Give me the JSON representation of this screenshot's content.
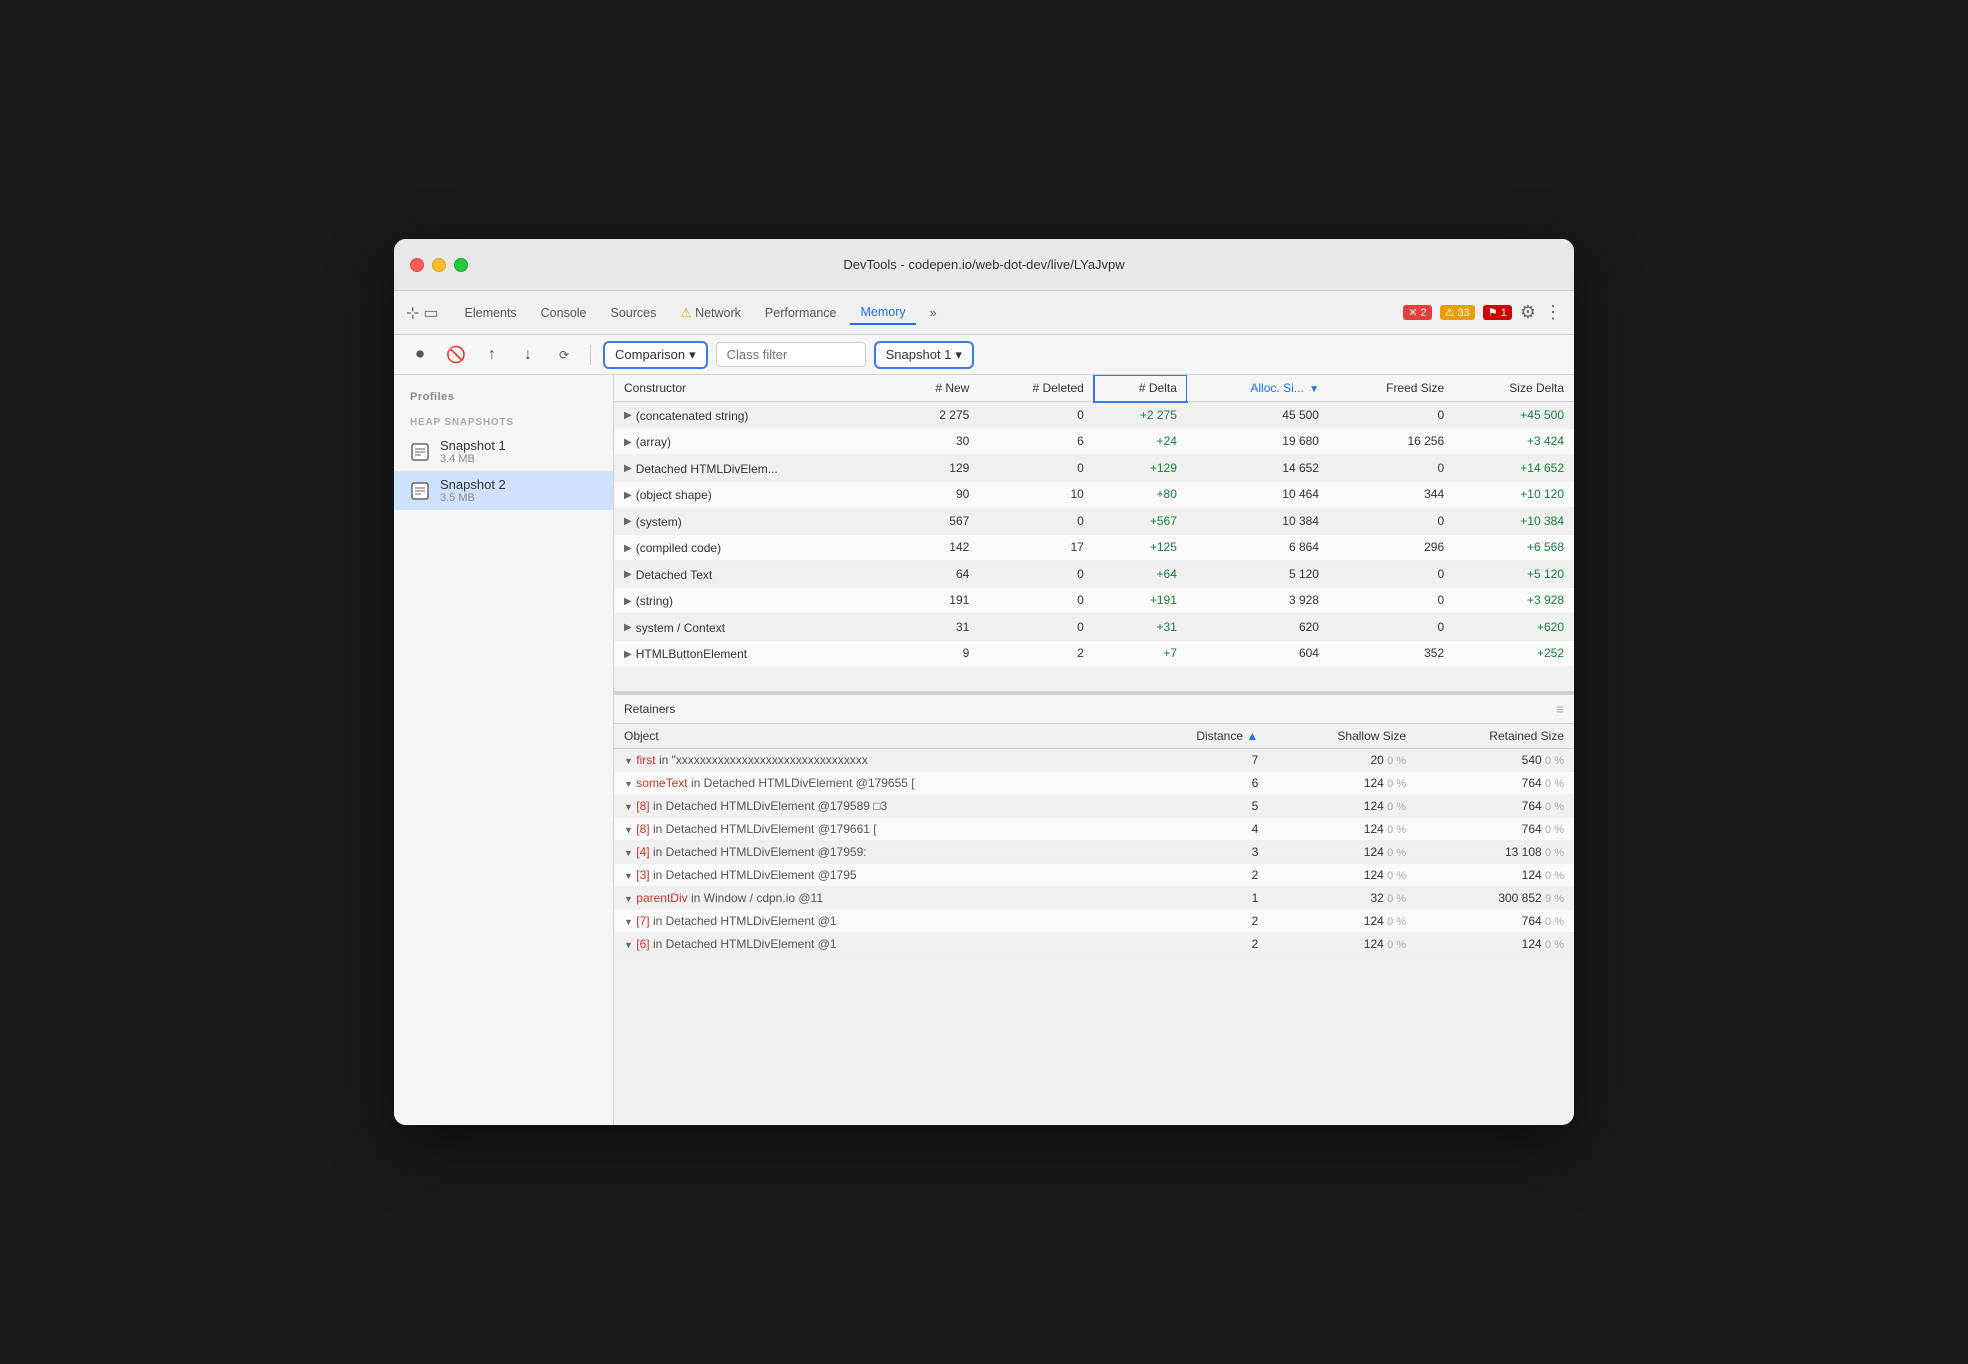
{
  "window": {
    "title": "DevTools - codepen.io/web-dot-dev/live/LYaJvpw"
  },
  "traffic_lights": {
    "red_label": "close",
    "yellow_label": "minimize",
    "green_label": "maximize"
  },
  "tabs": [
    {
      "label": "Elements",
      "active": false
    },
    {
      "label": "Console",
      "active": false
    },
    {
      "label": "Sources",
      "active": false
    },
    {
      "label": "⚠ Network",
      "active": false,
      "warn": true
    },
    {
      "label": "Performance",
      "active": false
    },
    {
      "label": "Memory",
      "active": true
    },
    {
      "label": "»",
      "active": false
    }
  ],
  "tab_badges": {
    "error_count": "2",
    "warn_count": "33",
    "info_count": "1"
  },
  "toolbar": {
    "comparison_label": "Comparison",
    "class_filter_placeholder": "Class filter",
    "snapshot_label": "Snapshot 1"
  },
  "table": {
    "columns": [
      "Constructor",
      "# New",
      "# Deleted",
      "# Delta",
      "Alloc. Si...",
      "Freed Size",
      "Size Delta"
    ],
    "sorted_col": "Alloc. Si...",
    "rows": [
      {
        "constructor": "(concatenated string)",
        "new": "2 275",
        "deleted": "0",
        "delta": "+2 275",
        "alloc_size": "45 500",
        "freed_size": "0",
        "size_delta": "+45 500"
      },
      {
        "constructor": "(array)",
        "new": "30",
        "deleted": "6",
        "delta": "+24",
        "alloc_size": "19 680",
        "freed_size": "16 256",
        "size_delta": "+3 424"
      },
      {
        "constructor": "Detached HTMLDivElem...",
        "new": "129",
        "deleted": "0",
        "delta": "+129",
        "alloc_size": "14 652",
        "freed_size": "0",
        "size_delta": "+14 652"
      },
      {
        "constructor": "(object shape)",
        "new": "90",
        "deleted": "10",
        "delta": "+80",
        "alloc_size": "10 464",
        "freed_size": "344",
        "size_delta": "+10 120"
      },
      {
        "constructor": "(system)",
        "new": "567",
        "deleted": "0",
        "delta": "+567",
        "alloc_size": "10 384",
        "freed_size": "0",
        "size_delta": "+10 384"
      },
      {
        "constructor": "(compiled code)",
        "new": "142",
        "deleted": "17",
        "delta": "+125",
        "alloc_size": "6 864",
        "freed_size": "296",
        "size_delta": "+6 568"
      },
      {
        "constructor": "Detached Text",
        "new": "64",
        "deleted": "0",
        "delta": "+64",
        "alloc_size": "5 120",
        "freed_size": "0",
        "size_delta": "+5 120"
      },
      {
        "constructor": "(string)",
        "new": "191",
        "deleted": "0",
        "delta": "+191",
        "alloc_size": "3 928",
        "freed_size": "0",
        "size_delta": "+3 928"
      },
      {
        "constructor": "system / Context",
        "new": "31",
        "deleted": "0",
        "delta": "+31",
        "alloc_size": "620",
        "freed_size": "0",
        "size_delta": "+620"
      },
      {
        "constructor": "HTMLButtonElement",
        "new": "9",
        "deleted": "2",
        "delta": "+7",
        "alloc_size": "604",
        "freed_size": "352",
        "size_delta": "+252"
      }
    ]
  },
  "retainers": {
    "header": "Retainers",
    "columns": [
      "Object",
      "Distance",
      "Shallow Size",
      "Retained Size"
    ],
    "rows": [
      {
        "indent": 0,
        "key": "first",
        "in_text": "in",
        "obj": "\"xxxxxxxxxxxxxxxxxxxxxxxxxxxxxxxx",
        "distance": "7",
        "shallow_size": "20",
        "shallow_pct": "0 %",
        "retained_size": "540",
        "retained_pct": "0 %"
      },
      {
        "indent": 1,
        "key": "someText",
        "in_text": "in",
        "obj": "Detached HTMLDivElement @179655 [",
        "distance": "6",
        "shallow_size": "124",
        "shallow_pct": "0 %",
        "retained_size": "764",
        "retained_pct": "0 %"
      },
      {
        "indent": 2,
        "key": "[8]",
        "in_text": "in",
        "obj": "Detached HTMLDivElement @179589 □3",
        "distance": "5",
        "shallow_size": "124",
        "shallow_pct": "0 %",
        "retained_size": "764",
        "retained_pct": "0 %"
      },
      {
        "indent": 3,
        "key": "[8]",
        "in_text": "in",
        "obj": "Detached HTMLDivElement @179661 [",
        "distance": "4",
        "shallow_size": "124",
        "shallow_pct": "0 %",
        "retained_size": "764",
        "retained_pct": "0 %"
      },
      {
        "indent": 4,
        "key": "[4]",
        "in_text": "in",
        "obj": "Detached HTMLDivElement @17959:",
        "distance": "3",
        "shallow_size": "124",
        "shallow_pct": "0 %",
        "retained_size": "13 108",
        "retained_pct": "0 %"
      },
      {
        "indent": 5,
        "key": "[3]",
        "in_text": "in",
        "obj": "Detached HTMLDivElement @1795",
        "distance": "2",
        "shallow_size": "124",
        "shallow_pct": "0 %",
        "retained_size": "124",
        "retained_pct": "0 %"
      },
      {
        "indent": 6,
        "key": "parentDiv",
        "in_text": "in",
        "obj": "Window / cdpn.io @11",
        "distance": "1",
        "shallow_size": "32",
        "shallow_pct": "0 %",
        "retained_size": "300 852",
        "retained_pct": "9 %"
      },
      {
        "indent": 5,
        "key": "[7]",
        "in_text": "in",
        "obj": "Detached HTMLDivElement @1",
        "distance": "2",
        "shallow_size": "124",
        "shallow_pct": "0 %",
        "retained_size": "764",
        "retained_pct": "0 %"
      },
      {
        "indent": 4,
        "key": "[6]",
        "in_text": "in",
        "obj": "Detached HTMLDivElement @1",
        "distance": "2",
        "shallow_size": "124",
        "shallow_pct": "0 %",
        "retained_size": "124",
        "retained_pct": "0 %"
      }
    ]
  },
  "sidebar": {
    "profiles_label": "Profiles",
    "heap_snapshots_label": "HEAP SNAPSHOTS",
    "snapshots": [
      {
        "name": "Snapshot 1",
        "size": "3.4 MB"
      },
      {
        "name": "Snapshot 2",
        "size": "3.5 MB",
        "active": true
      }
    ]
  },
  "icons": {
    "record": "⏺",
    "stop": "🚫",
    "upload": "↑",
    "download": "↓",
    "clear": "🗑",
    "settings": "⚙",
    "more": "⋮",
    "triangle_right": "▶",
    "triangle_down": "▼",
    "chevron_down": "▾",
    "sort_asc": "▲"
  }
}
